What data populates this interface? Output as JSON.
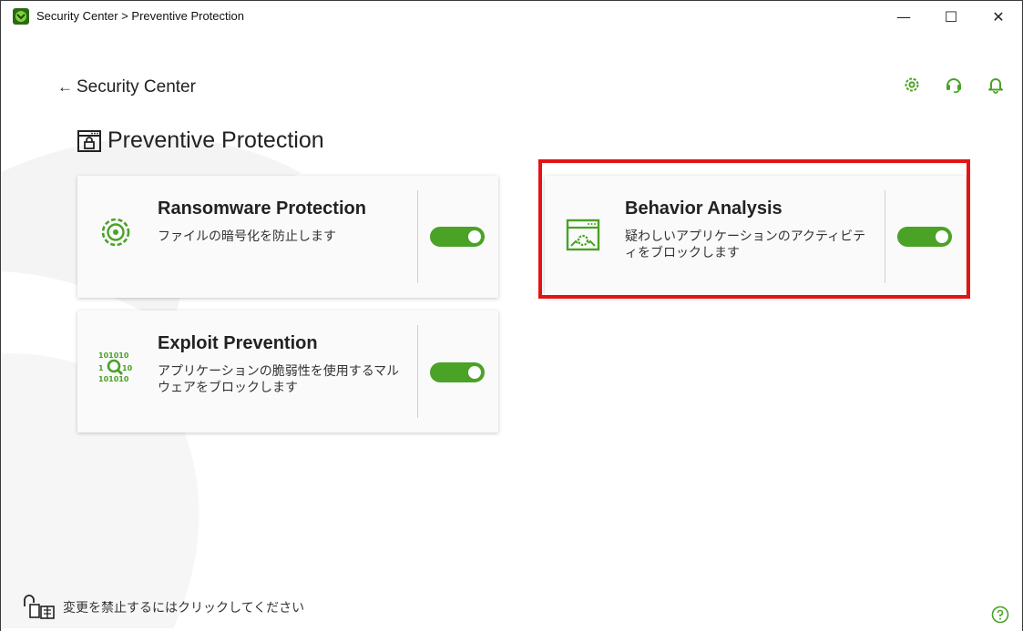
{
  "window": {
    "title": "Security Center > Preventive Protection",
    "controls": {
      "minimize": "—",
      "maximize": "☐",
      "close": "✕"
    }
  },
  "header": {
    "back_label": "Security Center",
    "icons": [
      "settings-icon",
      "support-icon",
      "notifications-icon"
    ]
  },
  "page": {
    "title": "Preventive Protection",
    "icon": "preventive-protection-icon"
  },
  "cards": [
    {
      "id": "ransomware",
      "title": "Ransomware Protection",
      "description": "ファイルの暗号化を防止します",
      "icon": "ransomware-gear-icon",
      "enabled": true
    },
    {
      "id": "behavior",
      "title": "Behavior Analysis",
      "description": "疑わしいアプリケーションのアクティビティをブロックします",
      "icon": "behavior-analysis-icon",
      "enabled": true,
      "highlighted": true
    },
    {
      "id": "exploit",
      "title": "Exploit Prevention",
      "description": "アプリケーションの脆弱性を使用するマルウェアをブロックします",
      "icon": "exploit-binary-search-icon",
      "enabled": true
    }
  ],
  "footer": {
    "lock_text": "変更を禁止するにはクリックしてください",
    "help_icon": "help-icon"
  },
  "colors": {
    "accent": "#4aa226",
    "highlight": "#e31414",
    "card_bg": "#fafafa"
  }
}
